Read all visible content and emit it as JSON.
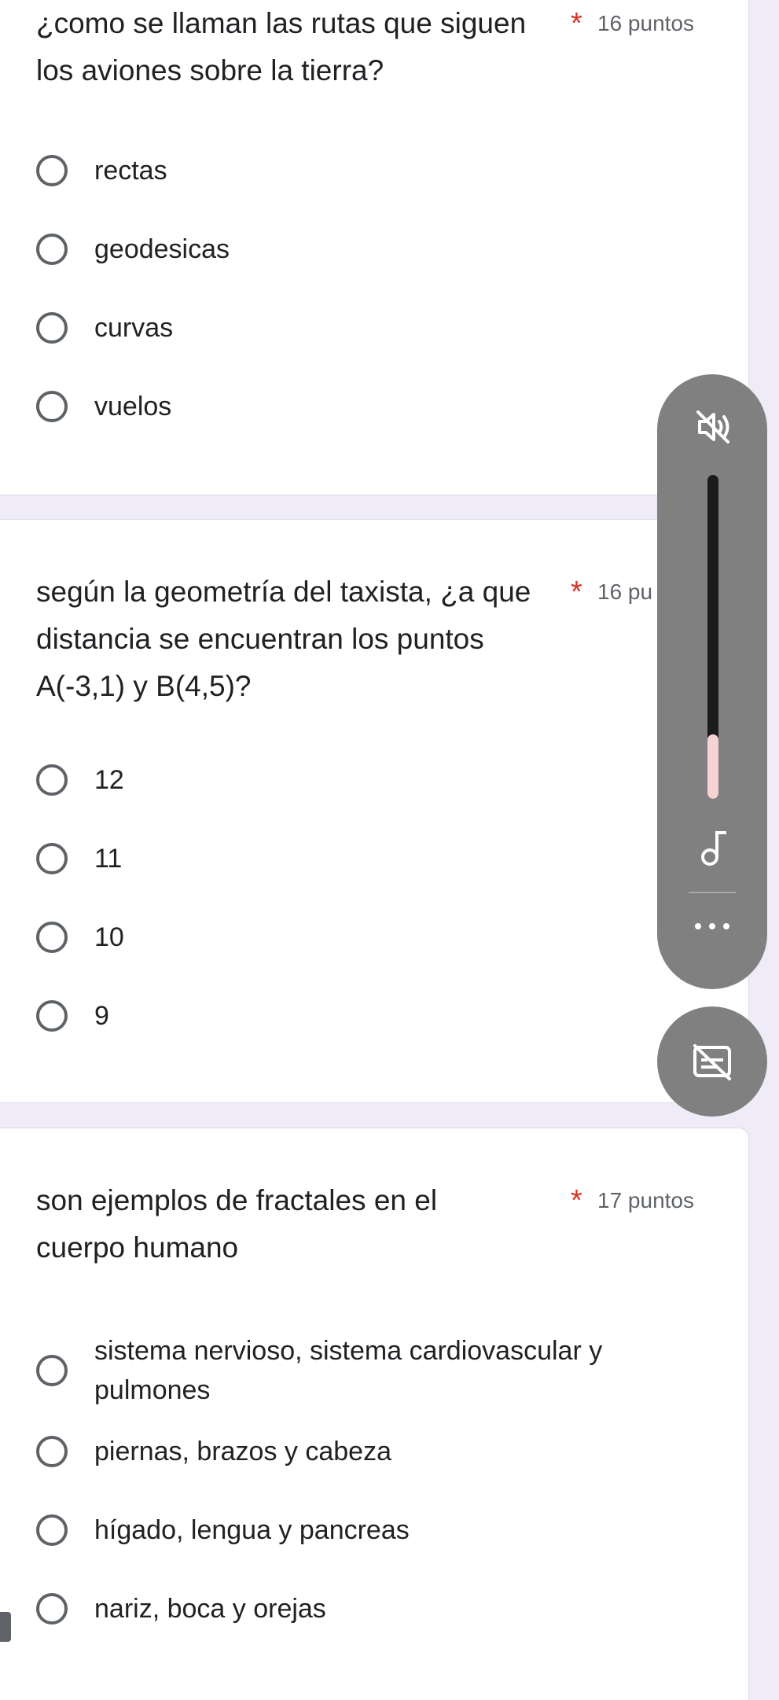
{
  "questions": [
    {
      "text": "¿como se llaman las rutas que siguen los aviones sobre la tierra?",
      "required_mark": "*",
      "points": "16 puntos",
      "options": [
        "rectas",
        "geodesicas",
        "curvas",
        "vuelos"
      ]
    },
    {
      "text": "según la geometría del taxista, ¿a que distancia se encuentran los puntos A(-3,1) y B(4,5)?",
      "required_mark": "*",
      "points": "16 pu",
      "options": [
        "12",
        "11",
        "10",
        "9"
      ]
    },
    {
      "text": "son ejemplos de fractales en el cuerpo humano",
      "required_mark": "*",
      "points": "17 puntos",
      "options": [
        "sistema nervioso, sistema cardiovascular y pulmones",
        "piernas, brazos y cabeza",
        "hígado, lengua y pancreas",
        "nariz, boca y orejas"
      ]
    }
  ],
  "overlay": {
    "volume_level": 0.2,
    "icons": [
      "volume-muted-icon",
      "music-note-icon",
      "more-options-icon",
      "captions-off-icon"
    ],
    "colors": {
      "panel": "#808080",
      "track": "#1b1b1b",
      "fill": "#f6d3d3"
    }
  },
  "colors": {
    "required": "#d93025",
    "background": "#efebf8"
  }
}
